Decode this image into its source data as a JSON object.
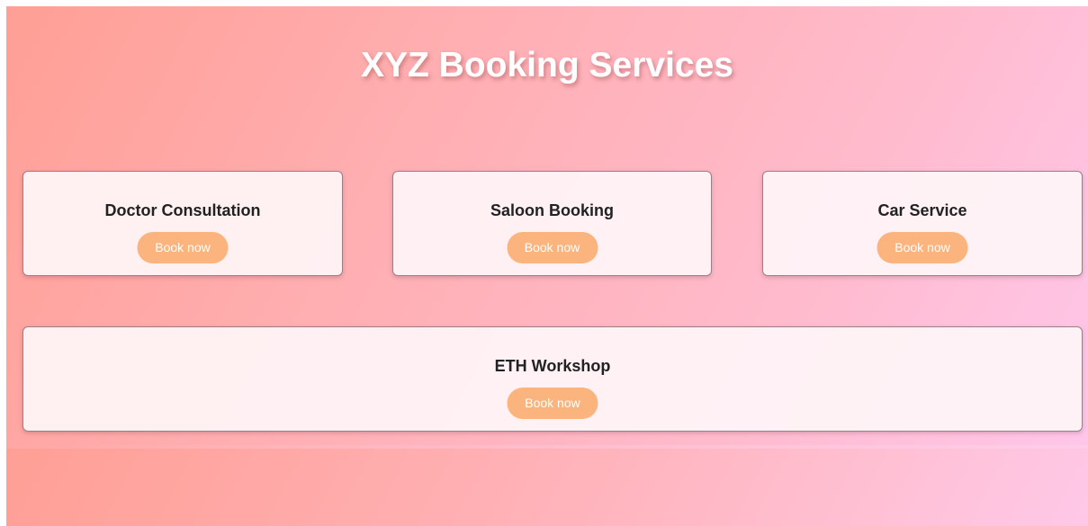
{
  "page": {
    "title": "XYZ Booking Services"
  },
  "services": [
    {
      "name": "Doctor Consultation",
      "button_label": "Book now"
    },
    {
      "name": "Saloon Booking",
      "button_label": "Book now"
    },
    {
      "name": "Car Service",
      "button_label": "Book now"
    },
    {
      "name": "ETH Workshop",
      "button_label": "Book now"
    }
  ],
  "colors": {
    "background_gradient_start": "#ff9f95",
    "background_gradient_end": "#ffc9ea",
    "card_background": "#fff5f7",
    "button_background": "#fbb47d",
    "title_text": "#ffffff",
    "card_title_text": "#222222"
  }
}
